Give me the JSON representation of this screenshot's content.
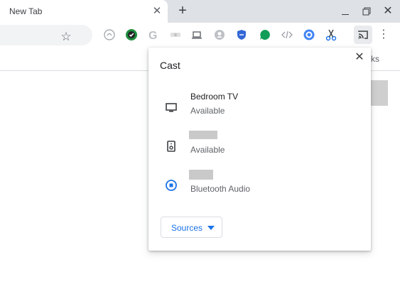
{
  "tab": {
    "title": "New Tab",
    "close": "✕"
  },
  "new_tab": "+",
  "window": {
    "close": "✕"
  },
  "toolbar": {
    "star": "☆",
    "menu": "⋮",
    "extensions": [
      "cloud-icon",
      "check-circle-icon",
      "google-icon",
      "rec-icon",
      "laptop-icon",
      "account-icon",
      "shield-icon",
      "chat-icon",
      "code-icon",
      "target-icon",
      "scissors-icon"
    ]
  },
  "bookmarks": {
    "fragment": "rks"
  },
  "cast": {
    "title": "Cast",
    "close": "✕",
    "sinks": [
      {
        "name": "Bedroom TV",
        "status": "Available",
        "icon": "tv-icon"
      },
      {
        "name": "",
        "status": "Available",
        "icon": "speaker-icon"
      },
      {
        "name": "",
        "status": "Bluetooth Audio",
        "icon": "bluetooth-audio-icon"
      }
    ],
    "sources_label": "Sources"
  },
  "colors": {
    "accent": "#1a73e8",
    "tabstrip": "#dee1e6",
    "omnibox": "#f1f3f4"
  }
}
